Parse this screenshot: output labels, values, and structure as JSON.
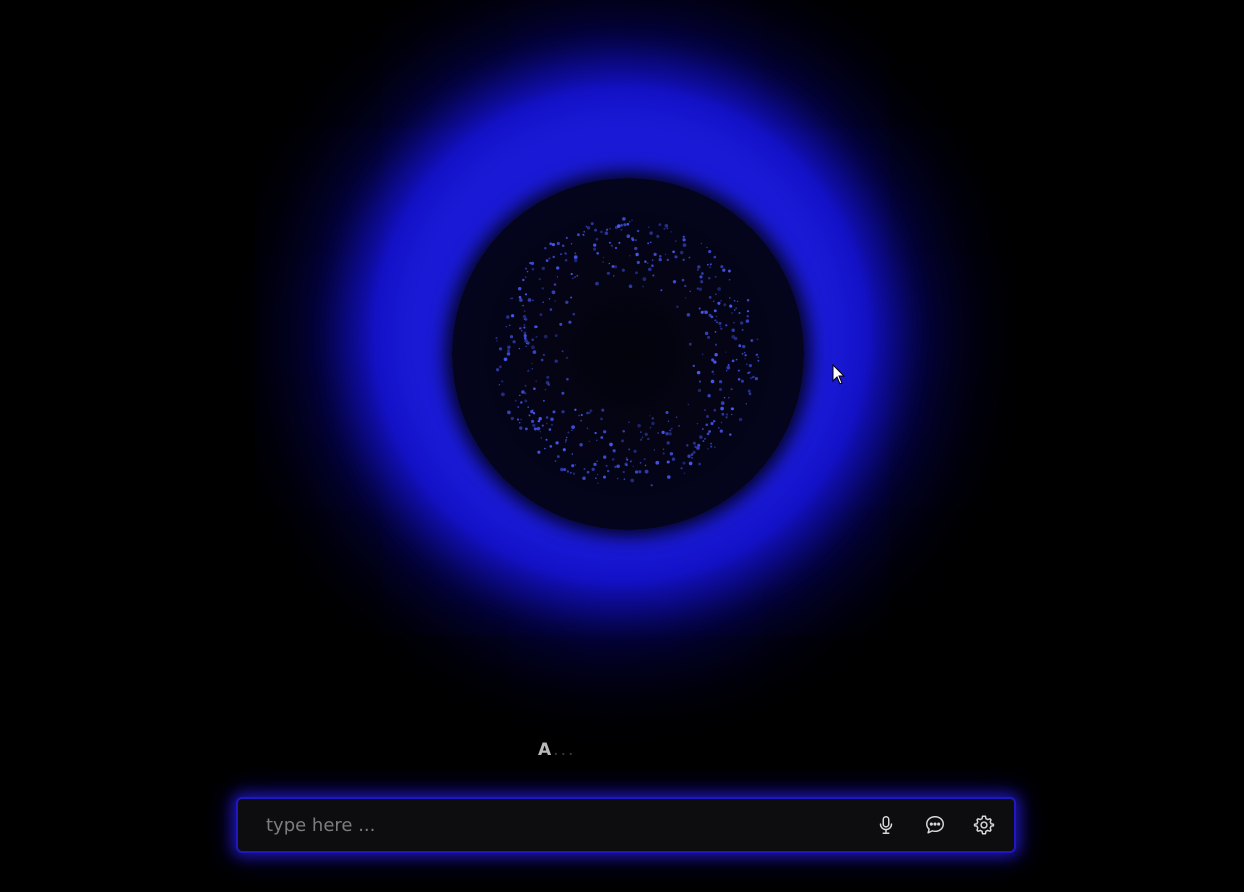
{
  "orb": {
    "glow_color": "#1a1ad6",
    "core_color": "#04041a",
    "particle_color": "#4a5cff"
  },
  "status": {
    "text": "A",
    "trailing": "..."
  },
  "input": {
    "placeholder": "type here ...",
    "value": ""
  },
  "toolbar": {
    "mic_icon": "microphone-icon",
    "chat_icon": "chat-bubble-icon",
    "settings_icon": "gear-icon"
  },
  "colors": {
    "background": "#000000",
    "bar_background": "#0d0d0f",
    "bar_glow": "#2a1ec8",
    "icon": "#d9d9d9",
    "placeholder": "#7d7d7d"
  }
}
